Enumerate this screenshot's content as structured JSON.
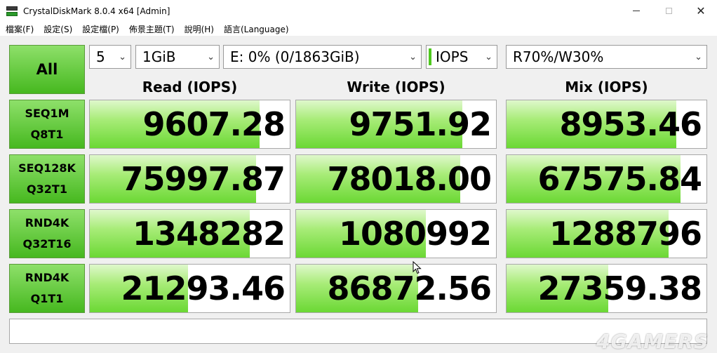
{
  "window": {
    "title": "CrystalDiskMark 8.0.4 x64 [Admin]"
  },
  "menu": [
    "檔案(F)",
    "設定(S)",
    "設定檔(P)",
    "佈景主題(T)",
    "說明(H)",
    "語言(Language)"
  ],
  "controls": {
    "all_label": "All",
    "count": "5",
    "size": "1GiB",
    "drive": "E: 0% (0/1863GiB)",
    "unit": "IOPS",
    "mix_ratio": "R70%/W30%"
  },
  "columns": [
    "Read (IOPS)",
    "Write (IOPS)",
    "Mix (IOPS)"
  ],
  "rows": [
    {
      "line1": "SEQ1M",
      "line2": "Q8T1",
      "read": "9607.28",
      "write": "9751.92",
      "mix": "8953.46",
      "read_fill": 0.85,
      "write_fill": 0.83,
      "mix_fill": 0.85
    },
    {
      "line1": "SEQ128K",
      "line2": "Q32T1",
      "read": "75997.87",
      "write": "78018.00",
      "mix": "67575.84",
      "read_fill": 0.83,
      "write_fill": 0.82,
      "mix_fill": 0.87
    },
    {
      "line1": "RND4K",
      "line2": "Q32T16",
      "read": "1348282",
      "write": "1080992",
      "mix": "1288796",
      "read_fill": 0.8,
      "write_fill": 0.65,
      "mix_fill": 0.81
    },
    {
      "line1": "RND4K",
      "line2": "Q1T1",
      "read": "21293.46",
      "write": "86872.56",
      "mix": "27359.38",
      "read_fill": 0.49,
      "write_fill": 0.61,
      "mix_fill": 0.51
    }
  ],
  "comment": "",
  "watermark": "4GAMERS",
  "colors": {
    "accent_green": "#4ec81e",
    "bar_green": "#6bd834"
  }
}
